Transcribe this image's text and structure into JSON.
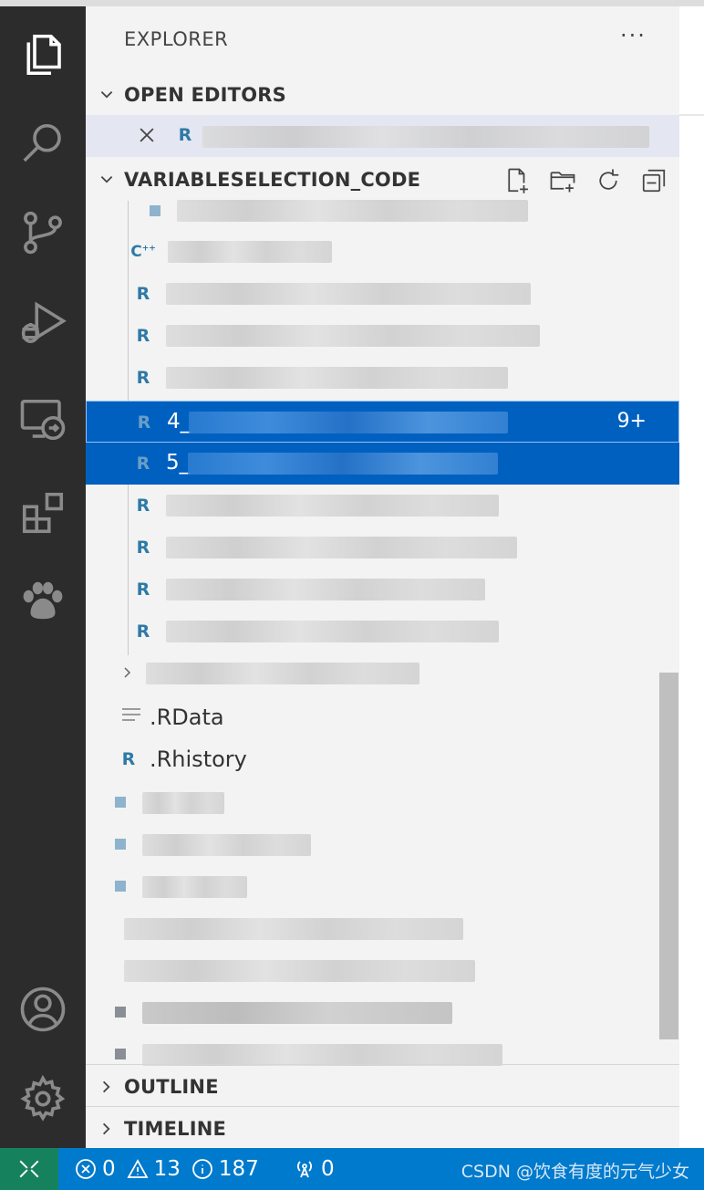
{
  "explorer": {
    "title": "EXPLORER",
    "more_label": "···"
  },
  "sections": {
    "open_editors": "OPEN EDITORS",
    "project": "VARIABLESELECTION_CODE",
    "outline": "OUTLINE",
    "timeline": "TIMELINE"
  },
  "activity_bar": {
    "items": [
      "files-icon",
      "search-icon",
      "source-control-icon",
      "run-debug-icon",
      "remote-explorer-icon",
      "extensions-icon",
      "paw-icon"
    ],
    "bottom": [
      "account-icon",
      "settings-gear-icon"
    ]
  },
  "files": {
    "selected_name_prefix": "4_",
    "selected_badge": "9+",
    "second_selected_prefix": "5_",
    "rdata": ".RData",
    "rhistory": ".Rhistory"
  },
  "status_bar": {
    "errors": "0",
    "warnings": "13",
    "infos": "187",
    "ports": "0",
    "watermark": "CSDN @饮食有度的元气少女"
  },
  "colors": {
    "accent": "#007acc",
    "selection": "#0060c0",
    "remote": "#16825d",
    "r_icon": "#2e7aa6"
  }
}
